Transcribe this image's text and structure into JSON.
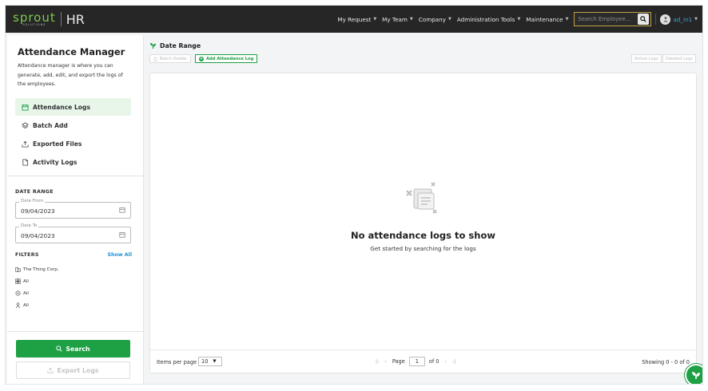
{
  "app": {
    "logo_text": "sprout",
    "logo_sub": "SOLUTIONS",
    "product": "HR"
  },
  "nav": {
    "items": [
      {
        "label": "My Request"
      },
      {
        "label": "My Team"
      },
      {
        "label": "Company"
      },
      {
        "label": "Administration Tools"
      },
      {
        "label": "Maintenance"
      }
    ],
    "search_placeholder": "Search Employee...",
    "user_name": "ad_in1"
  },
  "sidebar": {
    "title": "Attendance Manager",
    "description": "Attendance manager is where you can generate, add, edit, and export the logs of the employees.",
    "menu": [
      {
        "label": "Attendance Logs",
        "icon": "calendar-icon",
        "active": true
      },
      {
        "label": "Batch Add",
        "icon": "layers-icon",
        "active": false
      },
      {
        "label": "Exported Files",
        "icon": "export-icon",
        "active": false
      },
      {
        "label": "Activity Logs",
        "icon": "file-icon",
        "active": false
      }
    ],
    "date_range_label": "DATE RANGE",
    "date_from_label": "Date From",
    "date_from_value": "09/04/2023",
    "date_to_label": "Date To",
    "date_to_value": "09/04/2023",
    "filters_label": "FILTERS",
    "show_all": "Show All",
    "filters": [
      {
        "icon": "building-icon",
        "label": "The Thing Corp."
      },
      {
        "icon": "group-icon",
        "label": "All"
      },
      {
        "icon": "location-icon",
        "label": "All"
      },
      {
        "icon": "person-icon",
        "label": "All"
      }
    ],
    "search_button": "Search",
    "export_button": "Export Logs"
  },
  "main": {
    "header": "Date Range",
    "batch_delete": "Batch Delete",
    "add_log": "Add Attendance Log",
    "tab_active": "Active Logs",
    "tab_deleted": "Deleted Logs",
    "empty_title": "No attendance logs to show",
    "empty_subtitle": "Get started by searching for the logs",
    "items_per_page_label": "Items per page",
    "items_per_page_value": "10",
    "page_label": "Page",
    "page_value": "1",
    "page_of": "of 0",
    "showing": "Showing 0 - 0 of 0"
  },
  "colors": {
    "accent_green": "#1ea044",
    "topbar": "#262626",
    "link_blue": "#1f8fd6"
  }
}
